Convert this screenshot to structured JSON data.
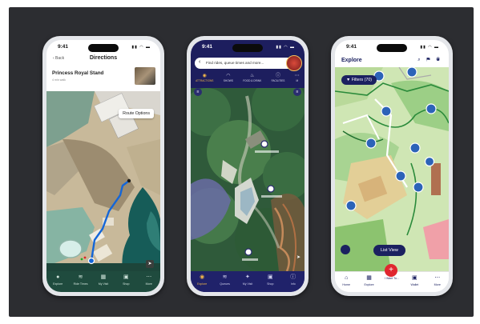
{
  "phones": {
    "directions": {
      "time": "9:41",
      "status_icons": "▮▮ ◠ ▬",
      "back_label": "‹ Back",
      "title": "Directions",
      "destination": "Princess Royal Stand",
      "distance": "4 min walk",
      "route_options_label": "Route Options",
      "location_button": "➤",
      "tabs": [
        {
          "icon": "●",
          "label": "Explore"
        },
        {
          "icon": "≋",
          "label": "Ride Times"
        },
        {
          "icon": "▦",
          "label": "My Visit"
        },
        {
          "icon": "▣",
          "label": "Shop"
        },
        {
          "icon": "⋯",
          "label": "More"
        }
      ]
    },
    "rides": {
      "time": "9:41",
      "status_icons": "▮▮ ◠ ▬",
      "search_arrow": "‹",
      "search_placeholder": "Find rides, queue times and more...",
      "categories": [
        {
          "icon": "◉",
          "label": "ATTRACTIONS"
        },
        {
          "icon": "◠",
          "label": "SHOWS"
        },
        {
          "icon": "♨",
          "label": "FOOD & DRINK"
        },
        {
          "icon": "ⓘ",
          "label": "FACILITIES"
        },
        {
          "icon": "⋯",
          "label": "M"
        }
      ],
      "menu_icon": "≡",
      "pointer_icon": "➤",
      "tabs": [
        {
          "icon": "◉",
          "label": "Explore"
        },
        {
          "icon": "≋",
          "label": "Queues"
        },
        {
          "icon": "✦",
          "label": "My Visit"
        },
        {
          "icon": "▣",
          "label": "Shop"
        },
        {
          "icon": "ⓘ",
          "label": "Info"
        }
      ]
    },
    "explore": {
      "time": "9:41",
      "status_icons": "▮▮ ◠ ▬",
      "title": "Explore",
      "header_icons": "⌕ ⚑ ◉",
      "filters_label": "▼ Filters (70)",
      "list_view_label": "List View",
      "fab_label": "+",
      "tabs": [
        {
          "icon": "⌂",
          "label": "Home"
        },
        {
          "icon": "▦",
          "label": "Explore"
        },
        {
          "icon": "",
          "label": "I Want To..."
        },
        {
          "icon": "▣",
          "label": "Wallet"
        },
        {
          "icon": "⋯",
          "label": "More"
        }
      ]
    }
  }
}
